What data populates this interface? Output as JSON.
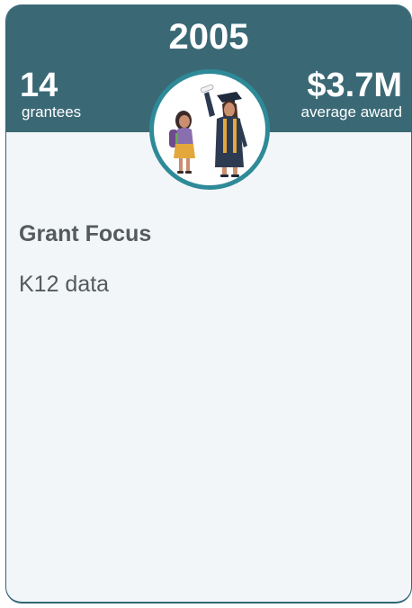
{
  "card": {
    "year": "2005",
    "grantees": {
      "value": "14",
      "label": "grantees"
    },
    "average_award": {
      "value": "$3.7M",
      "label": "average award"
    },
    "focus": {
      "title": "Grant Focus",
      "text": "K12 data"
    },
    "illustration_icon": "graduate-and-child-illustration",
    "colors": {
      "header": "#3a6975",
      "ring": "#2f8a98",
      "card_background": "#f2f6f9",
      "text": "#555a5d"
    }
  }
}
